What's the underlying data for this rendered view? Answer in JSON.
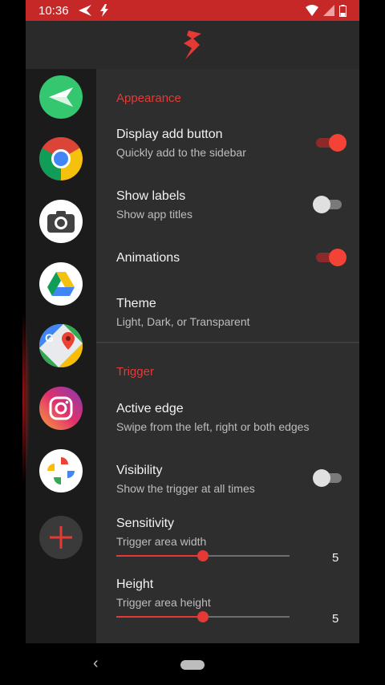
{
  "status_bar": {
    "time": "10:36"
  },
  "settings": {
    "appearance": {
      "title": "Appearance",
      "items": [
        {
          "title": "Display add button",
          "subtitle": "Quickly add to the sidebar",
          "toggle": true
        },
        {
          "title": "Show labels",
          "subtitle": "Show app titles",
          "toggle": false
        },
        {
          "title": "Animations",
          "subtitle": "",
          "toggle": true
        },
        {
          "title": "Theme",
          "subtitle": "Light, Dark, or Transparent"
        }
      ]
    },
    "trigger": {
      "title": "Trigger",
      "items": [
        {
          "title": "Active edge",
          "subtitle": "Swipe from the left, right or both edges"
        },
        {
          "title": "Visibility",
          "subtitle": "Show the trigger at all times",
          "toggle": false
        }
      ],
      "sliders": [
        {
          "title": "Sensitivity",
          "subtitle": "Trigger area width",
          "value": "5",
          "fraction": 0.5
        },
        {
          "title": "Height",
          "subtitle": "Trigger area height",
          "value": "5",
          "fraction": 0.5
        }
      ]
    }
  },
  "sidebar_apps": [
    "send-app-icon",
    "chrome-icon",
    "camera-icon",
    "drive-icon",
    "maps-icon",
    "instagram-icon",
    "photos-icon"
  ],
  "colors": {
    "accent": "#e53935",
    "status_bar": "#c62828",
    "background": "#2e2e2e",
    "sidebar": "#1b1b1b"
  }
}
